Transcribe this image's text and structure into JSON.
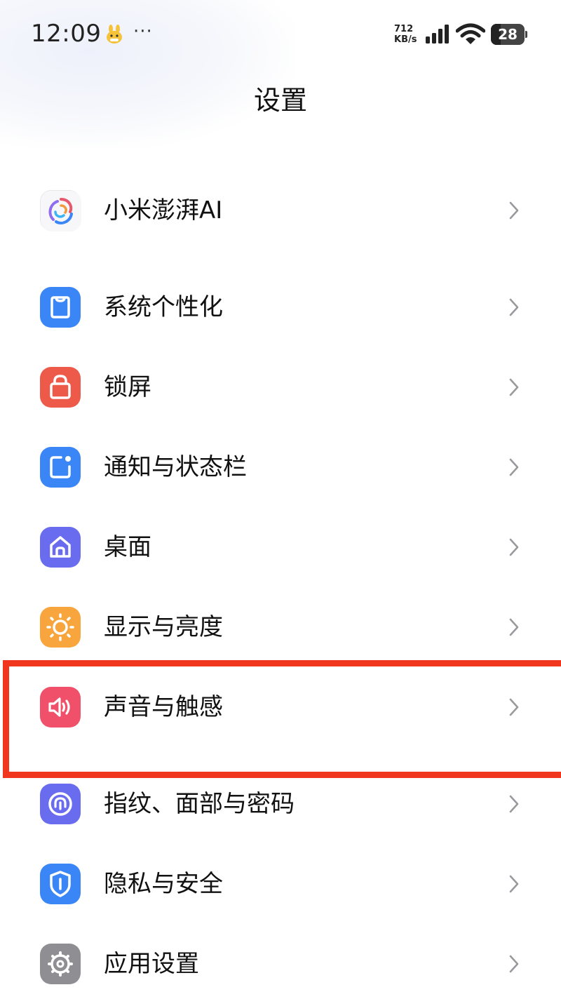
{
  "status_bar": {
    "time": "12:09",
    "more": "···",
    "net_speed_value": "712",
    "net_speed_unit": "KB/s",
    "battery": "28"
  },
  "header": {
    "title": "设置"
  },
  "settings": [
    {
      "label": "小米澎湃AI",
      "icon": "hyperos-ai-icon",
      "color": "#f5f5f7"
    },
    {
      "label": "系统个性化",
      "icon": "personalization-icon",
      "color": "#3b86f6"
    },
    {
      "label": "锁屏",
      "icon": "lock-screen-icon",
      "color": "#ee5a4a"
    },
    {
      "label": "通知与状态栏",
      "icon": "notification-icon",
      "color": "#3b86f6"
    },
    {
      "label": "桌面",
      "icon": "home-icon",
      "color": "#6a6cf0"
    },
    {
      "label": "显示与亮度",
      "icon": "brightness-icon",
      "color": "#f7a53c"
    },
    {
      "label": "声音与触感",
      "icon": "sound-icon",
      "color": "#f0506a"
    },
    {
      "label": "指纹、面部与密码",
      "icon": "fingerprint-icon",
      "color": "#6a6cf0"
    },
    {
      "label": "隐私与安全",
      "icon": "privacy-icon",
      "color": "#3b86f6"
    },
    {
      "label": "应用设置",
      "icon": "app-settings-icon",
      "color": "#8e8e93"
    }
  ],
  "highlight_color": "#f0361c"
}
